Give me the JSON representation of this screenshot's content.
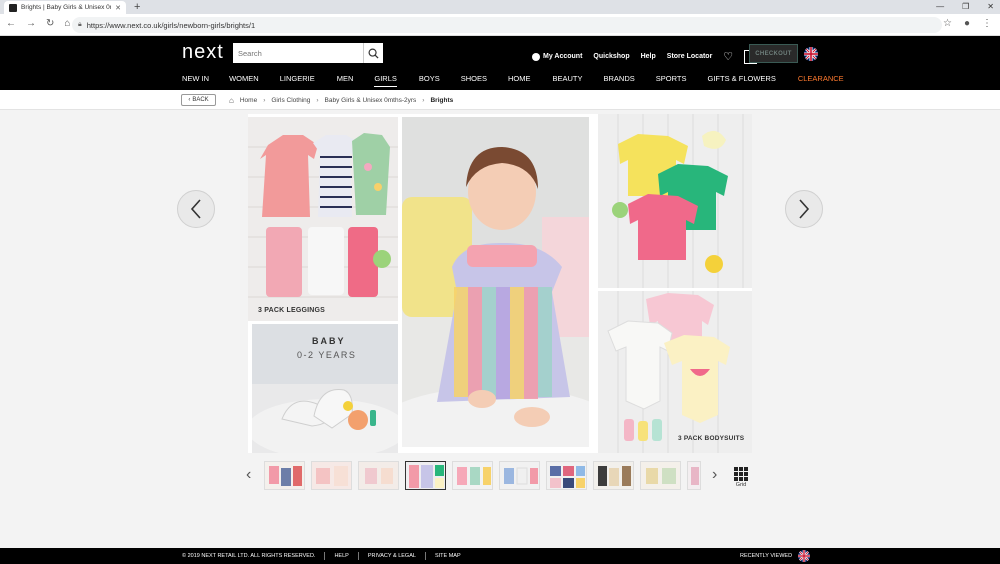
{
  "browser": {
    "tab_title": "Brights | Baby Girls & Unisex 0mt",
    "url": "https://www.next.co.uk/girls/newborn-girls/brights/1"
  },
  "header": {
    "logo": "next",
    "search_placeholder": "Search",
    "my_account": "My Account",
    "quickshop": "Quickshop",
    "help": "Help",
    "store_locator": "Store Locator",
    "bag_count": "0",
    "checkout": "CHECKOUT"
  },
  "nav": {
    "items": [
      "NEW IN",
      "WOMEN",
      "LINGERIE",
      "MEN",
      "GIRLS",
      "BOYS",
      "SHOES",
      "HOME",
      "BEAUTY",
      "BRANDS",
      "SPORTS",
      "GIFTS & FLOWERS",
      "CLEARANCE"
    ],
    "active": "GIRLS"
  },
  "breadcrumb": {
    "back": "BACK",
    "items": [
      "Home",
      "Girls Clothing",
      "Baby Girls & Unisex 0mths-2yrs",
      "Brights"
    ]
  },
  "gallery": {
    "label_leggings": "3 PACK LEGGINGS",
    "label_baby": "BABY",
    "label_age": "0-2 YEARS",
    "label_bodysuits": "3 PACK BODYSUITS"
  },
  "thumbnails": {
    "grid_label": "Grid"
  },
  "footer": {
    "copyright": "© 2019 NEXT RETAIL LTD. ALL RIGHTS RESERVED.",
    "help": "HELP",
    "privacy": "PRIVACY & LEGAL",
    "sitemap": "SITE MAP",
    "recently_viewed": "RECENTLY VIEWED"
  },
  "colors": {
    "header_bg": "#000000",
    "clearance": "#ff7a2f",
    "checkout_bg": "#2a2a2a",
    "page_bg": "#f3f3f3"
  }
}
